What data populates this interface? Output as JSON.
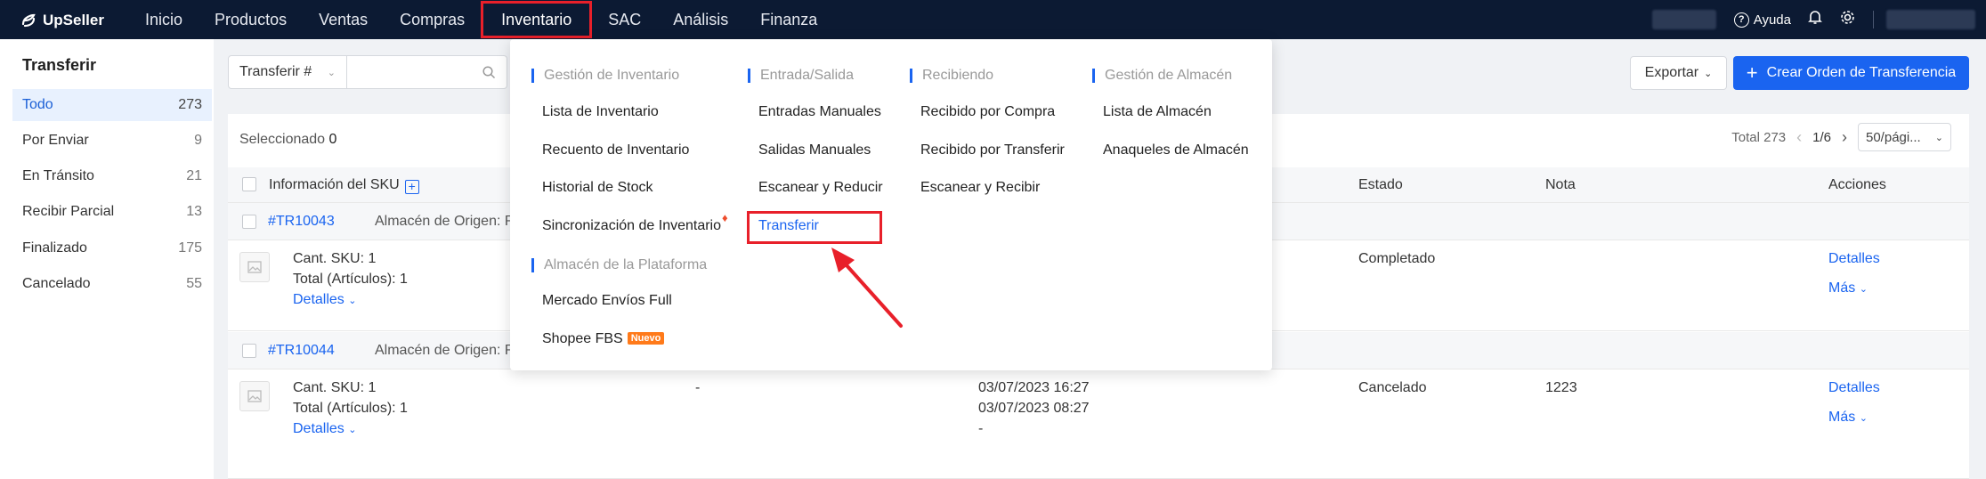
{
  "app": {
    "name": "UpSeller"
  },
  "nav": {
    "items": [
      "Inicio",
      "Productos",
      "Ventas",
      "Compras",
      "Inventario",
      "SAC",
      "Análisis",
      "Finanza"
    ],
    "active": "Inventario",
    "help_label": "Ayuda"
  },
  "sidebar": {
    "title": "Transferir",
    "items": [
      {
        "label": "Todo",
        "count": "273"
      },
      {
        "label": "Por Enviar",
        "count": "9"
      },
      {
        "label": "En Tránsito",
        "count": "21"
      },
      {
        "label": "Recibir Parcial",
        "count": "13"
      },
      {
        "label": "Finalizado",
        "count": "175"
      },
      {
        "label": "Cancelado",
        "count": "55"
      }
    ]
  },
  "toolbar": {
    "search_type": "Transferir #",
    "export_label": "Exportar",
    "create_label": "Crear Orden de Transferencia"
  },
  "table": {
    "selected_label": "Seleccionado",
    "selected_count": "0",
    "total_label": "Total 273",
    "page": "1/6",
    "page_size": "50/pági...",
    "columns": {
      "sku": "Información del SKU",
      "status": "Estado",
      "note": "Nota",
      "actions": "Acciones"
    },
    "rows": [
      {
        "id": "#TR10043",
        "origin": "Almacén de Origen: R",
        "qty_sku": "Cant. SKU: 1",
        "total": "Total (Artículos): 1",
        "details": "Detalles",
        "col2": "",
        "date1": "",
        "date2": "",
        "date3": "",
        "status": "Completado",
        "note": "",
        "action1": "Detalles",
        "action2": "Más"
      },
      {
        "id": "#TR10044",
        "origin": "Almacén de Origen: R",
        "qty_sku": "Cant. SKU: 1",
        "total": "Total (Artículos): 1",
        "details": "Detalles",
        "col2": "-",
        "date1": "03/07/2023 16:27",
        "date2": "03/07/2023 08:27",
        "date3": "-",
        "status": "Cancelado",
        "note": "1223",
        "action1": "Detalles",
        "action2": "Más"
      }
    ]
  },
  "dropdown": {
    "col1": {
      "heading": "Gestión de Inventario",
      "items": [
        "Lista de Inventario",
        "Recuento de Inventario",
        "Historial de Stock",
        "Sincronización de Inventario"
      ],
      "heading2": "Almacén de la Plataforma",
      "items2": [
        "Mercado Envíos Full",
        "Shopee FBS"
      ],
      "badge": "Nuevo"
    },
    "col2": {
      "heading": "Entrada/Salida",
      "items": [
        "Entradas Manuales",
        "Salidas Manuales",
        "Escanear y Reducir",
        "Transferir"
      ]
    },
    "col3": {
      "heading": "Recibiendo",
      "items": [
        "Recibido por Compra",
        "Recibido por Transferir",
        "Escanear y Recibir"
      ]
    },
    "col4": {
      "heading": "Gestión de Almacén",
      "items": [
        "Lista de Almacén",
        "Anaqueles de Almacén"
      ]
    }
  },
  "colors": {
    "nav_bg": "#0c1a33",
    "accent": "#1a64f0",
    "highlight": "#e8202a"
  }
}
